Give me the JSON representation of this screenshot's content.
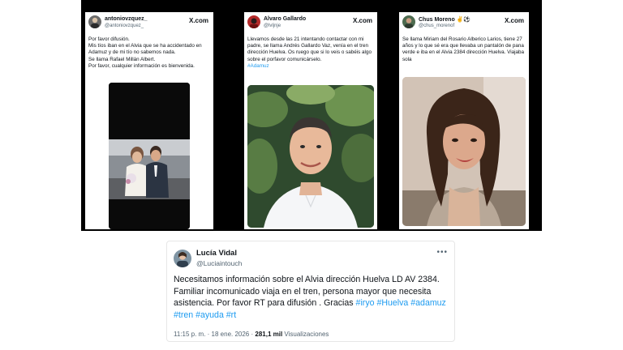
{
  "tweets": [
    {
      "name": "antoniovzquez_",
      "handle": "@antoniovzquez_",
      "brand": "X.com",
      "lines": [
        "Por favor difusión.",
        "Mis tíos iban en el Alvia que se ha accidentado en Adamuz y de mi tío no sabemos nada.",
        "Se llama Rafael Millán Albert.",
        "Por favor, cualquier información es bienvenida."
      ],
      "photo": "wedding-couple-photo"
    },
    {
      "name": "Alvaro Gallardo",
      "handle": "@lvljnje",
      "brand": "X.com",
      "text": "Llevamos desde las 21 intentando contactar con mi padre, se llama Andrés Gallardo Vaz, venía en el tren dirección Huelva. Os ruego que si lo veis o sabéis algo sobre el porfavor comunicárselo.",
      "hashtag": "#Adamuz",
      "photo": "man-portrait-photo"
    },
    {
      "name": "Chus Moreno",
      "badge": "✌️⚽",
      "handle": "@chus_morenof",
      "brand": "X.com",
      "text": "Se llama Miriam del Rosario Alberico Larios, tiene 27 años y lo que sé era que llevaba un pantalón de pana verde e iba en el Alvia 2384 dirección Huelva. Viajaba sola",
      "photo": "woman-portrait-photo"
    }
  ],
  "main_tweet": {
    "name": "Lucía Vidal",
    "handle": "@Luciaintouch",
    "more": "•••",
    "text": "Necesitamos información sobre el Alvia dirección Huelva LD AV 2384. Familiar incomunicado viaja en el tren, persona mayor que necesita asistencia. Por favor RT para difusión . Gracias",
    "hashtags": "#iryo #Huelva #adamuz #tren #ayuda #rt",
    "time": "11:15 p. m.",
    "date": "18 ene. 2026",
    "views_count": "281,1 mil",
    "views_label": "Visualizaciones"
  }
}
